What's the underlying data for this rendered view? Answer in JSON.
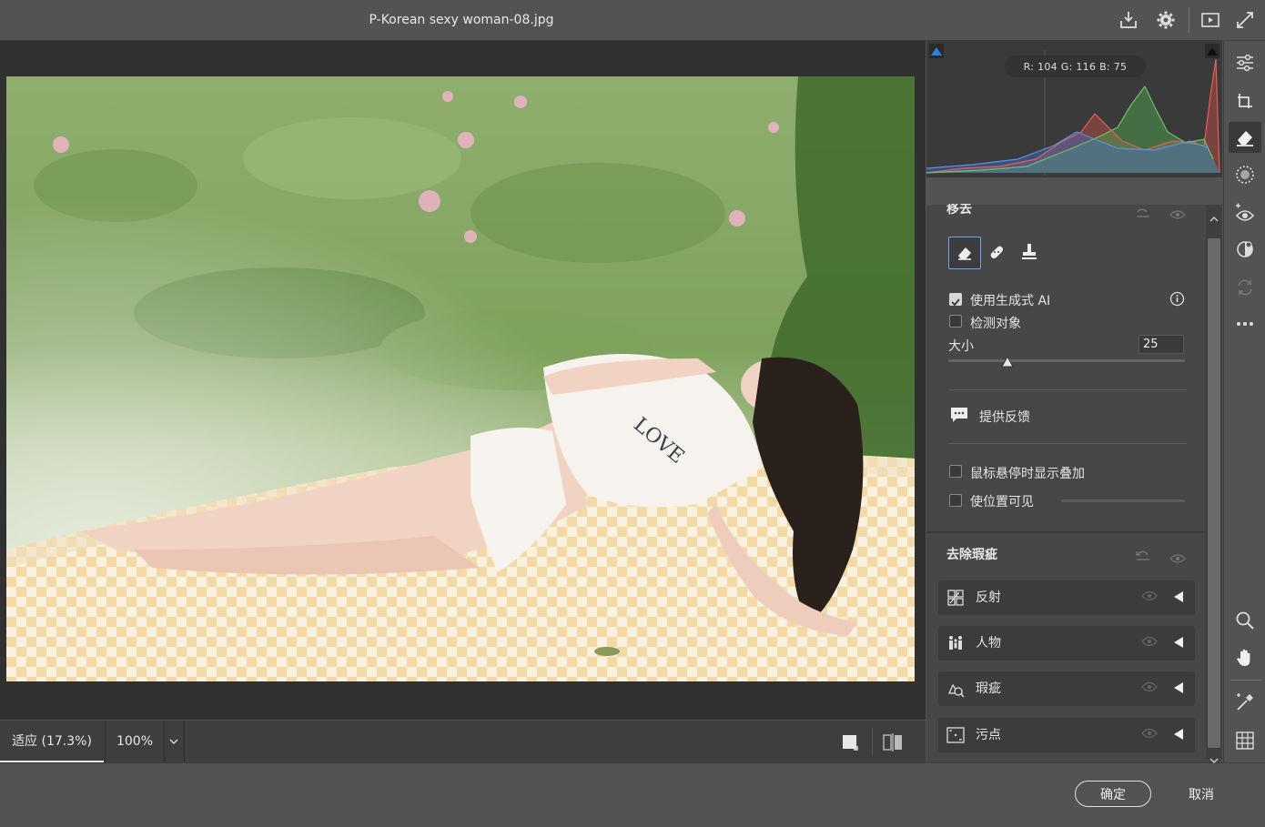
{
  "window": {
    "title": "P-Korean sexy woman-08.jpg"
  },
  "histogram": {
    "readout": "R: 104   G: 116   B: 75"
  },
  "remove_panel": {
    "title": "移去",
    "use_generative_ai": {
      "label": "使用生成式 AI",
      "checked": true
    },
    "detect_objects": {
      "label": "检测对象",
      "checked": false
    },
    "size": {
      "label": "大小",
      "value": "25",
      "level": 0.25
    },
    "feedback_label": "提供反馈",
    "show_overlay_on_hover": {
      "label": "鼠标悬停时显示叠加",
      "checked": false
    },
    "visualize_spots": {
      "label": "使位置可见",
      "checked": false
    }
  },
  "distraction_panel": {
    "title": "去除瑕疵",
    "items": [
      {
        "label": "反射",
        "icon": "reflection-icon"
      },
      {
        "label": "人物",
        "icon": "people-icon"
      },
      {
        "label": "瑕疵",
        "icon": "distraction-icon"
      },
      {
        "label": "污点",
        "icon": "dust-icon"
      }
    ]
  },
  "statusbar": {
    "zoom_fit": "适应 (17.3%)",
    "zoom_100": "100%"
  },
  "dialog": {
    "ok": "确定",
    "cancel": "取消"
  }
}
